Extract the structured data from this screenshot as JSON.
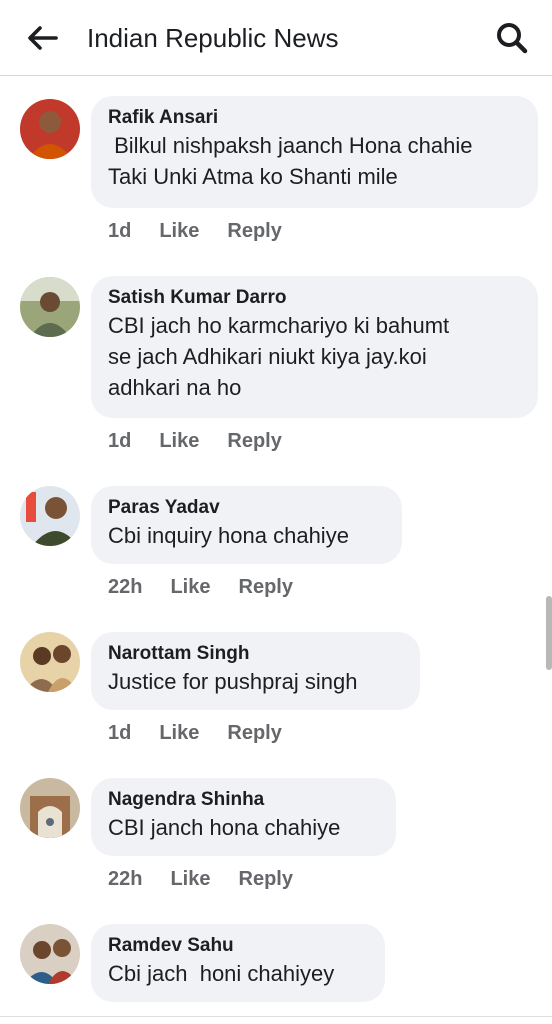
{
  "header": {
    "title": "Indian Republic News",
    "back_icon": "arrow-left-icon",
    "search_icon": "search-icon"
  },
  "comments": [
    {
      "name": "Rafik Ansari",
      "text": " Bilkul nishpaksh jaanch Hona chahie\nTaki Unki Atma ko Shanti mile",
      "time": "1d",
      "like": "Like",
      "reply": "Reply"
    },
    {
      "name": "Satish Kumar Darro",
      "text": "CBI jach ho karmchariyo ki bahumt\nse jach Adhikari niukt kiya jay.koi\nadhkari na ho",
      "time": "1d",
      "like": "Like",
      "reply": "Reply"
    },
    {
      "name": "Paras Yadav",
      "text": "Cbi inquiry hona chahiye",
      "time": "22h",
      "like": "Like",
      "reply": "Reply"
    },
    {
      "name": "Narottam Singh",
      "text": "Justice for pushpraj singh",
      "time": "1d",
      "like": "Like",
      "reply": "Reply"
    },
    {
      "name": "Nagendra Shinha",
      "text": "CBI janch hona chahiye",
      "time": "22h",
      "like": "Like",
      "reply": "Reply"
    },
    {
      "name": "Ramdev Sahu",
      "text": "Cbi jach  honi chahiyey",
      "time": "",
      "like": "",
      "reply": ""
    }
  ],
  "colors": {
    "bubble": "#f0f2f5",
    "meta": "#65676b",
    "text": "#1c1e21"
  }
}
